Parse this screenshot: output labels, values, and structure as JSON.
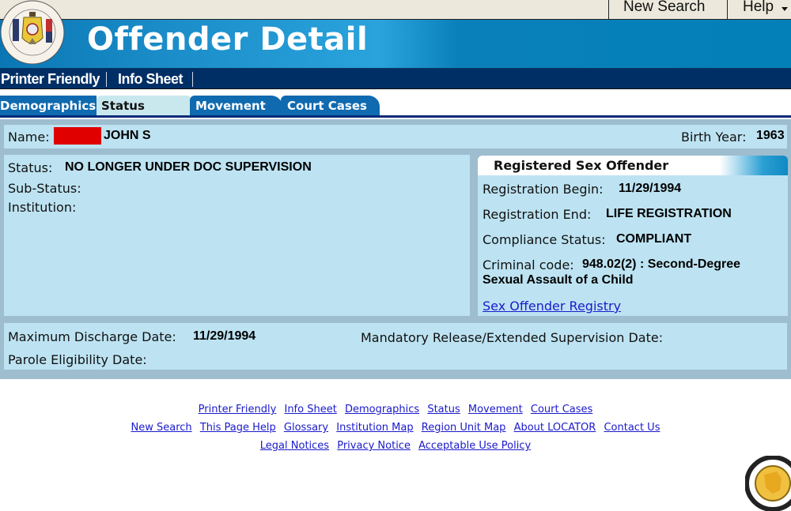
{
  "topbar": {
    "new_search": "New Search",
    "help": "Help"
  },
  "banner": {
    "title": "Offender Detail",
    "seal_label": "Wisconsin Department of Corrections seal"
  },
  "navbar": {
    "printer_friendly": "Printer Friendly",
    "info_sheet": "Info Sheet"
  },
  "tabs": [
    {
      "label": "Demographics",
      "active": false
    },
    {
      "label": "Status",
      "active": true
    },
    {
      "label": "Movement",
      "active": false
    },
    {
      "label": "Court Cases",
      "active": false
    }
  ],
  "offender": {
    "name_label": "Name:",
    "name_value": "JOHN S",
    "birth_year_label": "Birth Year:",
    "birth_year_value": "1963"
  },
  "status_panel": {
    "status_label": "Status:",
    "status_value": "NO LONGER UNDER DOC SUPERVISION",
    "substatus_label": "Sub-Status:",
    "substatus_value": "",
    "institution_label": "Institution:",
    "institution_value": ""
  },
  "rso_panel": {
    "title": "Registered Sex Offender",
    "reg_begin_label": "Registration Begin:",
    "reg_begin_value": "11/29/1994",
    "reg_end_label": "Registration End:",
    "reg_end_value": "LIFE REGISTRATION",
    "compliance_label": "Compliance Status:",
    "compliance_value": "COMPLIANT",
    "criminal_code_label": "Criminal code:",
    "criminal_code_value_line1": "948.02(2) : Second-Degree",
    "criminal_code_value_line2": "Sexual Assault of a Child",
    "registry_link": "Sex Offender Registry"
  },
  "dates_panel": {
    "max_discharge_label": "Maximum Discharge Date:",
    "max_discharge_value": "11/29/1994",
    "mandatory_release_label": "Mandatory Release/Extended Supervision Date:",
    "mandatory_release_value": "",
    "parole_label": "Parole Eligibility Date:",
    "parole_value": ""
  },
  "footer": {
    "row1": [
      "Printer Friendly",
      "Info Sheet",
      "Demographics",
      "Status",
      "Movement",
      "Court Cases"
    ],
    "row2": [
      "New Search",
      "This Page Help",
      "Glossary",
      "Institution Map",
      "Region Unit Map",
      "About LOCATOR",
      "Contact Us"
    ],
    "row3": [
      "Legal Notices",
      "Privacy Notice",
      "Acceptable Use Policy"
    ]
  },
  "colors": {
    "banner_blue": "#0380b8",
    "navbar_navy": "#002f66",
    "tab_blue": "#0f6ab0",
    "panel_bg": "#bde3f2",
    "content_bg": "#9ebdcf",
    "link_blue": "#1a1acc",
    "redaction_red": "#e00000"
  }
}
